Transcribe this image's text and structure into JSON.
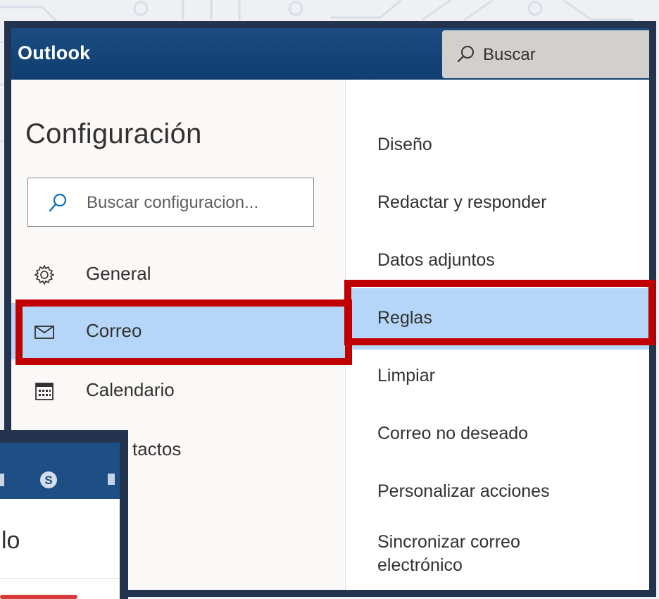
{
  "app": {
    "title": "Outlook"
  },
  "top_search": {
    "label": "Buscar",
    "icon": "search-icon"
  },
  "settings": {
    "title": "Configuración",
    "search_placeholder": "Buscar configuracion...",
    "nav": [
      {
        "label": "General",
        "icon": "gear-icon",
        "selected": false
      },
      {
        "label": "Correo",
        "icon": "mail-icon",
        "selected": true
      },
      {
        "label": "Calendario",
        "icon": "calendar-icon",
        "selected": false
      },
      {
        "label": "tactos",
        "icon": "people-icon",
        "selected": false
      }
    ],
    "mail_options": [
      {
        "label": "Diseño"
      },
      {
        "label": "Redactar y responder"
      },
      {
        "label": "Datos adjuntos"
      },
      {
        "label": "Reglas",
        "selected": true
      },
      {
        "label": "Limpiar"
      },
      {
        "label": "Correo no deseado"
      },
      {
        "label": "Personalizar acciones"
      },
      {
        "label": "Sincronizar correo",
        "label_line2": "electrónico"
      }
    ]
  },
  "secondary_window": {
    "text": "lo",
    "icon": "skype-icon"
  },
  "colors": {
    "header": "#0f3e6f",
    "frame": "#24344f",
    "selected": "#b5d6f8",
    "highlight": "#c00000"
  }
}
